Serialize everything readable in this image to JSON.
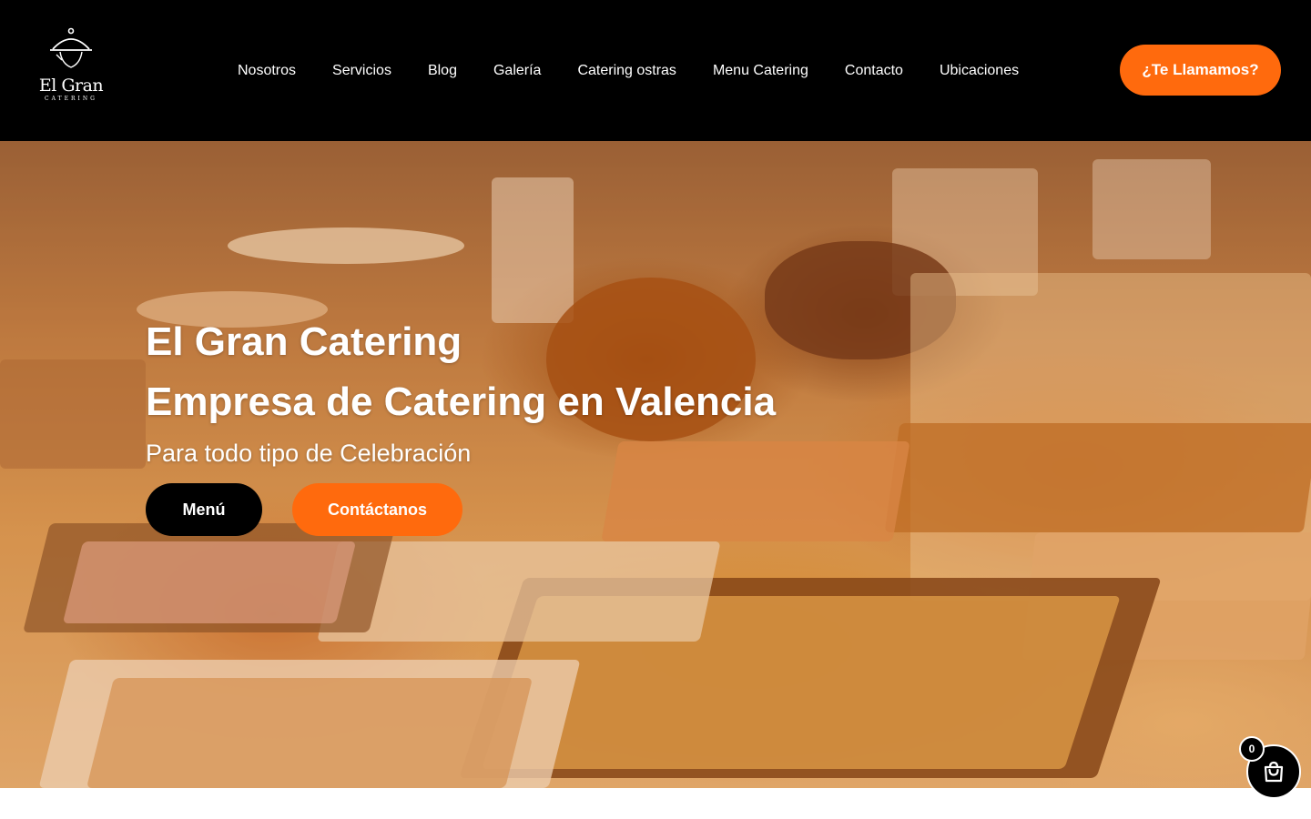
{
  "header": {
    "logo": {
      "title": "El Gran",
      "subtitle": "CATERING",
      "icon": "cloche-icon"
    },
    "nav": [
      {
        "label": "Nosotros"
      },
      {
        "label": "Servicios"
      },
      {
        "label": "Blog"
      },
      {
        "label": "Galería"
      },
      {
        "label": "Catering ostras"
      },
      {
        "label": "Menu Catering"
      },
      {
        "label": "Contacto"
      },
      {
        "label": "Ubicaciones"
      }
    ],
    "call_button": "¿Te Llamamos?"
  },
  "hero": {
    "title": "El Gran Catering",
    "subtitle": "Empresa de Catering en Valencia",
    "tagline": "Para todo tipo de Celebración",
    "menu_button": "Menú",
    "contact_button": "Contáctanos"
  },
  "cart": {
    "count": "0",
    "icon": "shopping-bag-icon"
  },
  "colors": {
    "header_bg": "#000000",
    "accent": "#ff6a0d",
    "text": "#ffffff"
  }
}
